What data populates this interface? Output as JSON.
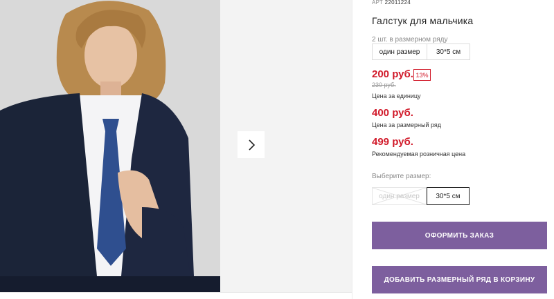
{
  "product": {
    "article_label": "АРТ",
    "article_code": "22011224",
    "title": "Галстук для мальчика",
    "pack": {
      "label": "2 шт. в размерном ряду",
      "chips": [
        "один размер",
        "30*5 см"
      ]
    },
    "prices": {
      "unit_price": "200 руб.",
      "discount": "13%",
      "old_price": "230 руб.",
      "unit_caption": "Цена за единицу",
      "series_price": "400 руб.",
      "series_caption": "Цена за размерный ряд",
      "retail_price": "499 руб.",
      "retail_caption": "Рекомендуемая розничная цена"
    },
    "size_select": {
      "label": "Выберите размер:",
      "options": [
        {
          "label": "один размер",
          "available": false
        },
        {
          "label": "30*5 см",
          "available": true,
          "selected": true
        }
      ]
    },
    "buttons": {
      "order": "ОФОРМИТЬ ЗАКАЗ",
      "add_series": "ДОБАВИТЬ РАЗМЕРНЫЙ РЯД В КОРЗИНУ"
    }
  },
  "gallery": {
    "next_icon": "chevron-right-icon"
  },
  "colors": {
    "price_red": "#d11a2a",
    "button_purple": "#7d5f9e"
  }
}
